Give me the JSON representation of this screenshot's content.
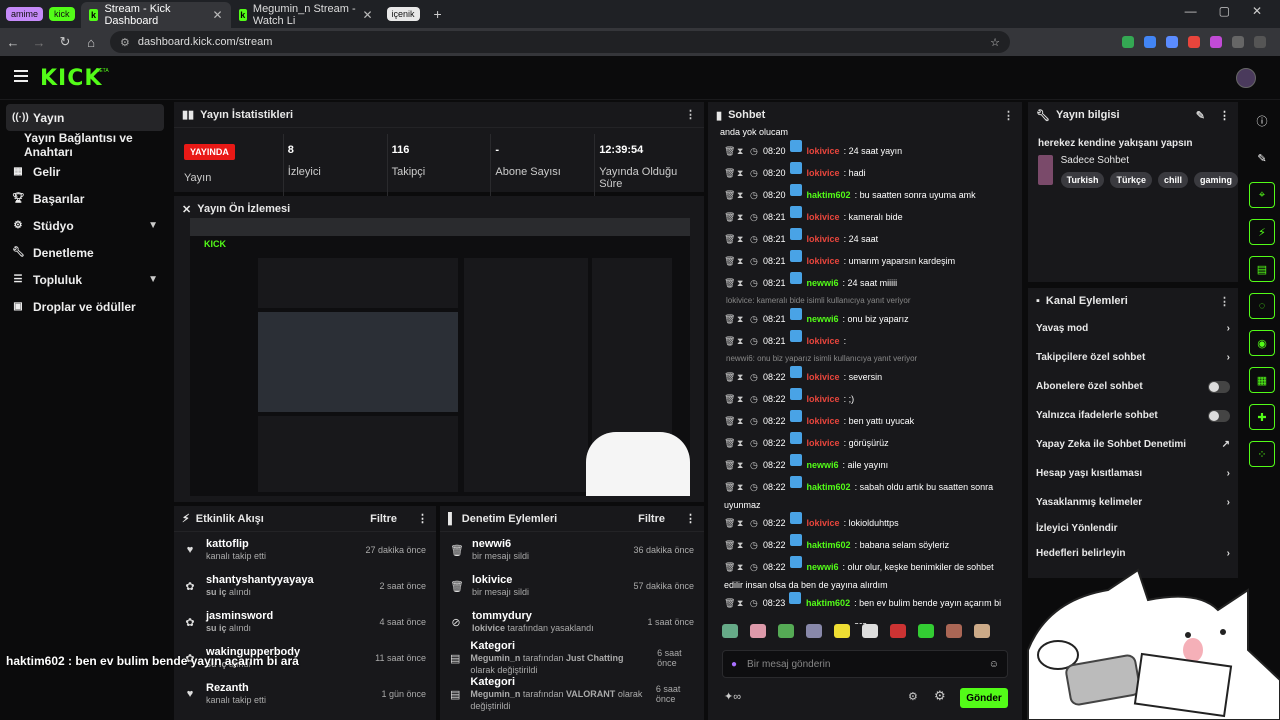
{
  "browser": {
    "tab_groups": [
      {
        "label": "amime",
        "color": "#c58af9"
      },
      {
        "label": "kick",
        "color": "#53fc18"
      },
      {
        "label": "içenik",
        "color": "#e8e8e8"
      }
    ],
    "tabs": [
      {
        "title": "Stream - Kick Dashboard",
        "active": true
      },
      {
        "title": "Megumin_n Stream - Watch Li",
        "active": false
      }
    ],
    "url": "dashboard.kick.com/stream"
  },
  "site": {
    "logo": "KICK",
    "beta": "BETA"
  },
  "sidebar": {
    "items": [
      {
        "label": "Yayın",
        "icon": "broadcast-icon",
        "active": true
      },
      {
        "label": "Yayın Bağlantısı ve Anahtarı",
        "icon": "",
        "sub": true
      },
      {
        "label": "Gelir",
        "icon": "chart-icon"
      },
      {
        "label": "Başarılar",
        "icon": "trophy-icon"
      },
      {
        "label": "Stüdyo",
        "icon": "studio-icon",
        "chevron": true
      },
      {
        "label": "Denetleme",
        "icon": "wrench-icon"
      },
      {
        "label": "Topluluk",
        "icon": "community-icon",
        "chevron": true
      },
      {
        "label": "Droplar ve ödüller",
        "icon": "drops-icon"
      }
    ]
  },
  "stats": {
    "title": "Yayın İstatistikleri",
    "live_badge": "YAYINDA",
    "live_label": "Yayın",
    "viewers": "8",
    "viewers_label": "İzleyici",
    "followers": "116",
    "followers_label": "Takipçi",
    "subs": "-",
    "subs_label": "Abone Sayısı",
    "duration": "12:39:54",
    "duration_label": "Yayında Olduğu Süre"
  },
  "preview": {
    "title": "Yayın Ön İzlemesi"
  },
  "activity": {
    "title": "Etkinlik Akışı",
    "filter": "Filtre",
    "items": [
      {
        "user": "kattoflip",
        "desc": "kanalı takip etti",
        "time": "27 dakika önce",
        "icon": "heart-icon"
      },
      {
        "user": "shantyshantyyayaya",
        "desc_green": "su iç",
        "desc": " alındı",
        "time": "2 saat önce",
        "icon": "reward-icon"
      },
      {
        "user": "jasminsword",
        "desc_green": "su iç",
        "desc": " alındı",
        "time": "4 saat önce",
        "icon": "reward-icon"
      },
      {
        "user": "wakingupperbody",
        "desc_green": "su iç",
        "desc": " alındı",
        "time": "11 saat önce",
        "icon": "reward-icon"
      },
      {
        "user": "Rezanth",
        "desc": "kanalı takip etti",
        "time": "1 gün önce",
        "icon": "heart-icon"
      }
    ]
  },
  "moderation": {
    "title": "Denetim Eylemleri",
    "filter": "Filtre",
    "items": [
      {
        "user": "newwi6",
        "desc": "bir mesajı sildi",
        "time": "36 dakika önce",
        "icon": "trash-icon"
      },
      {
        "user": "lokivice",
        "desc": "bir mesajı sildi",
        "time": "57 dakika önce",
        "icon": "trash-icon"
      },
      {
        "user": "tommydury",
        "desc_green": "lokivice",
        "desc": " tarafından yasaklandı",
        "time": "1 saat önce",
        "icon": "ban-icon"
      },
      {
        "user": "Kategori",
        "desc_green": "Megumin_n",
        "desc": " tarafından ",
        "desc_green2": "Just Chatting",
        "desc2": " olarak değiştirildi",
        "time": "6 saat önce",
        "icon": "category-icon"
      },
      {
        "user": "Kategori",
        "desc_green": "Megumin_n",
        "desc": " tarafından ",
        "desc_green2": "VALORANT",
        "desc2": " olarak değiştirildi",
        "time": "6 saat önce",
        "icon": "category-icon"
      }
    ]
  },
  "chat": {
    "title": "Sohbet",
    "first_line": "anda yok olucam",
    "messages": [
      {
        "time": "08:20",
        "user": "lokivice",
        "color": "red",
        "text": ": 24 saat yayın"
      },
      {
        "time": "08:20",
        "user": "lokivice",
        "color": "red",
        "text": ": hadi"
      },
      {
        "time": "08:20",
        "user": "haktim602",
        "color": "green",
        "text": ": bu saatten sonra uyuma amk"
      },
      {
        "time": "08:21",
        "user": "lokivice",
        "color": "red",
        "text": ": kameralı bide"
      },
      {
        "time": "08:21",
        "user": "lokivice",
        "color": "red",
        "text": ": 24 saat"
      },
      {
        "time": "08:21",
        "user": "lokivice",
        "color": "red",
        "text": ": umarım yaparsın kardeşim"
      },
      {
        "time": "08:21",
        "user": "newwi6",
        "color": "green",
        "text": ": 24 saat miiiii"
      },
      {
        "reply": "lokivice: kameralı bide isimli kullanıcıya yanıt veriyor"
      },
      {
        "time": "08:21",
        "user": "newwi6",
        "color": "green",
        "text": ": onu biz yaparız"
      },
      {
        "time": "08:21",
        "user": "lokivice",
        "color": "red",
        "text": ": "
      },
      {
        "reply": "newwi6: onu biz yaparız isimli kullanıcıya yanıt veriyor"
      },
      {
        "time": "08:22",
        "user": "lokivice",
        "color": "red",
        "text": ": seversin"
      },
      {
        "time": "08:22",
        "user": "lokivice",
        "color": "red",
        "text": ": ;)"
      },
      {
        "time": "08:22",
        "user": "lokivice",
        "color": "red",
        "text": ": ben yattı uyucak"
      },
      {
        "time": "08:22",
        "user": "lokivice",
        "color": "red",
        "text": ": görüşürüz"
      },
      {
        "time": "08:22",
        "user": "newwi6",
        "color": "green",
        "text": ": aile yayını"
      },
      {
        "time": "08:22",
        "user": "haktim602",
        "color": "green",
        "text": ": sabah oldu artık bu saatten sonra"
      },
      {
        "plain": "uyunmaz"
      },
      {
        "time": "08:22",
        "user": "lokivice",
        "color": "red",
        "text": ": lokiolduhttps"
      },
      {
        "time": "08:22",
        "user": "haktim602",
        "color": "green",
        "text": ": babana selam söyleriz"
      },
      {
        "time": "08:22",
        "user": "newwi6",
        "color": "green",
        "text": ": olur olur, keşke benimkiler de sohbet"
      },
      {
        "plain": "edilir insan olsa da ben de yayına alırdım"
      },
      {
        "time": "08:23",
        "user": "haktim602",
        "color": "green",
        "text": ": ben ev bulim bende yayın açarım bi ara"
      }
    ],
    "input_placeholder": "Bir mesaj gönderin",
    "send": "Gönder"
  },
  "stream_info": {
    "title": "Yayın bilgisi",
    "stream_title": "herekez kendine yakışanı yapsın",
    "category": "Sadece Sohbet",
    "tags": [
      "Turkish",
      "Türkçe",
      "chill",
      "gaming"
    ]
  },
  "channel_actions": {
    "title": "Kanal Eylemleri",
    "items": [
      {
        "label": "Yavaş mod",
        "ctl": "chevron"
      },
      {
        "label": "Takipçilere özel sohbet",
        "ctl": "chevron"
      },
      {
        "label": "Abonelere özel sohbet",
        "ctl": "toggle"
      },
      {
        "label": "Yalnızca ifadelerle sohbet",
        "ctl": "toggle"
      },
      {
        "label": "Yapay Zeka ile Sohbet Denetimi",
        "ctl": "external"
      },
      {
        "label": "Hesap yaşı kısıtlaması",
        "ctl": "chevron"
      },
      {
        "label": "Yasaklanmış kelimeler",
        "ctl": "chevron"
      },
      {
        "label": "İzleyici Yönlendir",
        "ctl": "none"
      },
      {
        "label": "Hedefleri belirleyin",
        "ctl": "chevron"
      }
    ]
  },
  "overlay_text": "haktim602 : ben ev bulim bende yayın açarım bi ara",
  "colors": {
    "accent": "#53fc18",
    "live": "#e91916",
    "badge": "#49a3e6",
    "red_user": "#e8453c"
  }
}
